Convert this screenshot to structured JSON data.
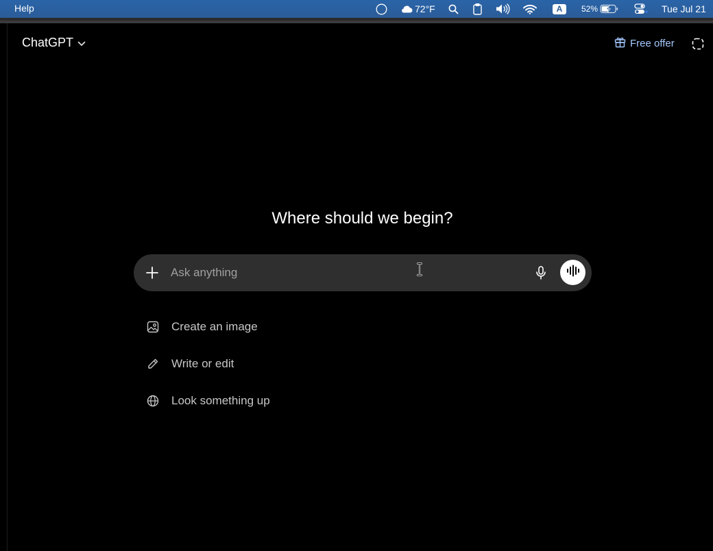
{
  "menubar": {
    "help_label": "Help",
    "weather": "72°F",
    "input_source": "A",
    "battery": "52%",
    "datetime": "Tue Jul 21",
    "icons": [
      "circle-icon",
      "cloud-icon",
      "search-icon",
      "clipboard-icon",
      "volume-icon",
      "wifi-icon",
      "battery-icon",
      "control-center-icon"
    ]
  },
  "app": {
    "model_name": "ChatGPT",
    "free_offer_label": "Free offer"
  },
  "main": {
    "heading": "Where should we begin?",
    "composer": {
      "placeholder": "Ask anything"
    },
    "suggestions": [
      {
        "label": "Create an image",
        "icon": "image-icon"
      },
      {
        "label": "Write or edit",
        "icon": "pencil-icon"
      },
      {
        "label": "Look something up",
        "icon": "globe-icon"
      }
    ]
  },
  "colors": {
    "background": "#000000",
    "composer_bg": "#2f2f2f",
    "accent_link": "#a5c8ff",
    "menubar": "#2b5c98"
  }
}
